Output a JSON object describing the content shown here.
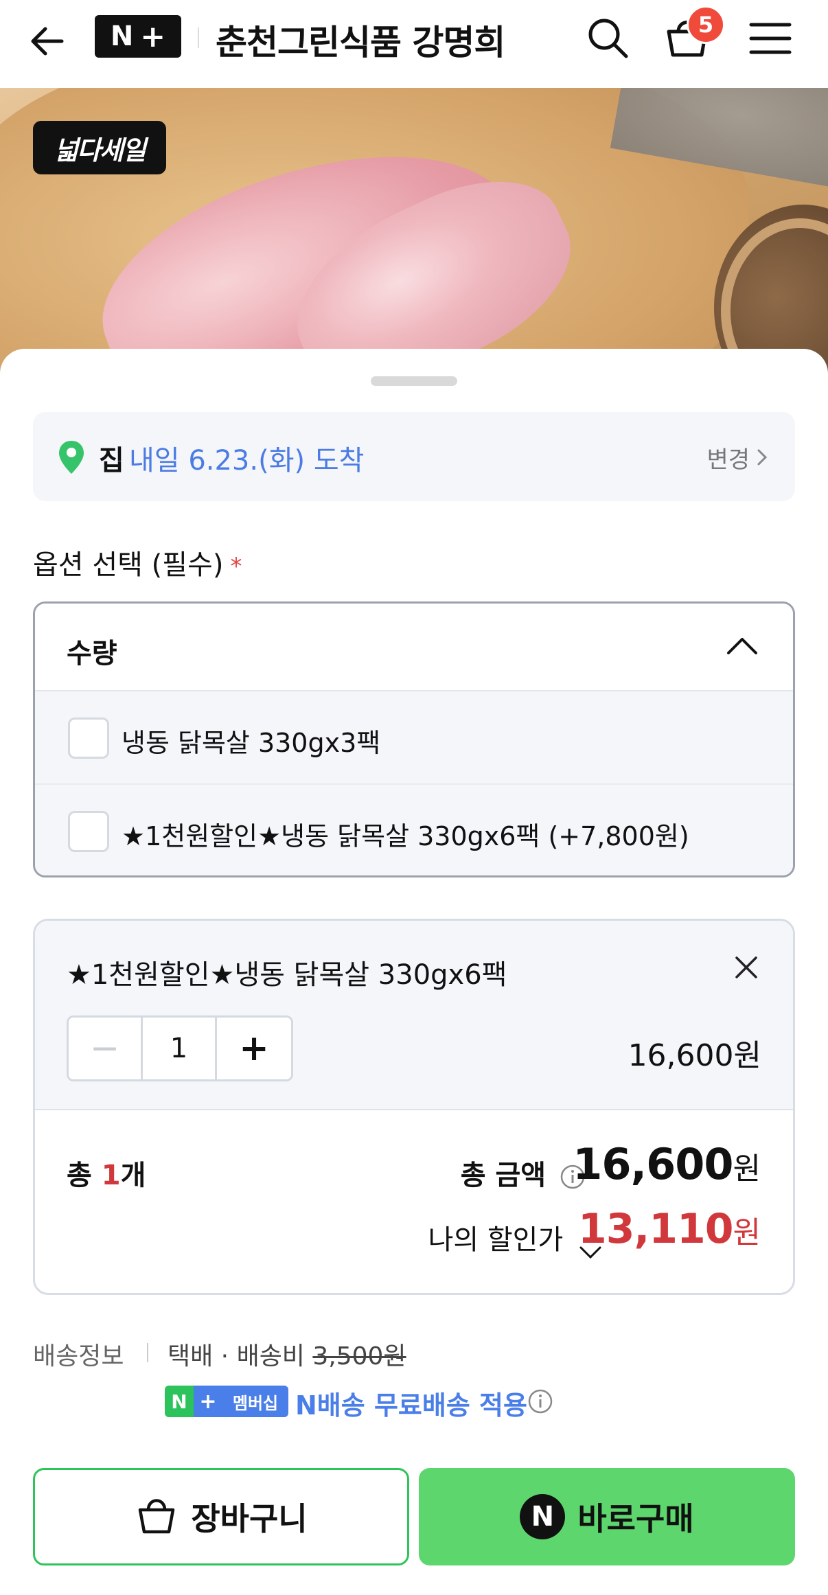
{
  "header": {
    "brand": {
      "n": "N",
      "plus": "+"
    },
    "store_name": "춘천그린식품 강명희",
    "cart_count": "5"
  },
  "hero": {
    "sale_badge": "넓다세일"
  },
  "delivery": {
    "place": "집",
    "arrival": "내일 6.23.(화) 도착",
    "change": "변경"
  },
  "options": {
    "title": "옵션 선택 (필수)",
    "required_mark": "*",
    "dropdown_label": "수량",
    "items": [
      {
        "label": "냉동 닭목살 330gx3팩",
        "checked": false
      },
      {
        "label": "★1천원할인★냉동 닭목살 330gx6팩 (+7,800원)",
        "checked": false
      }
    ]
  },
  "selected": {
    "name": "★1천원할인★냉동 닭목살 330gx6팩",
    "quantity": "1",
    "minus": "−",
    "plus": "+",
    "price": "16,600원"
  },
  "totals": {
    "count_prefix": "총 ",
    "count_num": "1",
    "count_suffix": "개",
    "amount_label": "총 금액",
    "amount": "16,600",
    "amount_unit": "원",
    "discount_label": "나의 할인가",
    "discount_amount": "13,110",
    "discount_unit": "원"
  },
  "shipping": {
    "label": "배송정보",
    "method": "택배 · 배송비 ",
    "fee": "3,500원",
    "membership_n": "N",
    "membership_plus": "+",
    "membership_text": "멤버십",
    "free_text": "N배송 무료배송 적용"
  },
  "buttons": {
    "cart": "장바구니",
    "buy_n": "N",
    "buy": "바로구매"
  },
  "colors": {
    "accent_green": "#5ed66e",
    "link_blue": "#4b7be3",
    "price_red": "#d0383c",
    "badge_red": "#f04a3a"
  }
}
